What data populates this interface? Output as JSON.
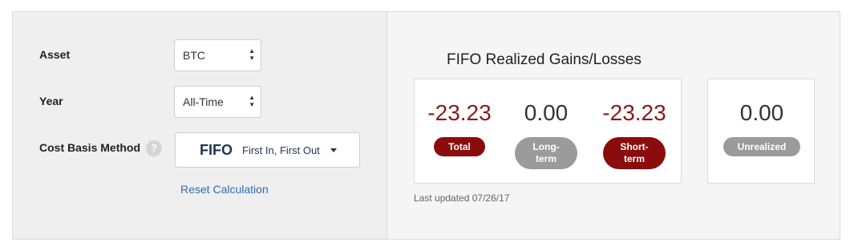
{
  "form": {
    "asset_label": "Asset",
    "asset_value": "BTC",
    "year_label": "Year",
    "year_value": "All-Time",
    "method_label": "Cost Basis Method",
    "help_icon": "?",
    "method_abbr": "FIFO",
    "method_full": "First In, First Out",
    "reset_label": "Reset Calculation"
  },
  "gains": {
    "title": "FIFO Realized Gains/Losses",
    "total_value": "-23.23",
    "total_label": "Total",
    "long_value": "0.00",
    "long_label_1": "Long-",
    "long_label_2": "term",
    "short_value": "-23.23",
    "short_label_1": "Short-",
    "short_label_2": "term",
    "unrealized_value": "0.00",
    "unrealized_label": "Unrealized",
    "last_updated": "Last updated 07/26/17"
  },
  "colors": {
    "negative": "#8b1a1a",
    "pill_red": "#8b0c0c",
    "pill_gray": "#9b9b9b",
    "link": "#2b6fb6"
  },
  "icons": {
    "select_arrows": "updown-arrows-icon",
    "dropdown_caret": "caret-down-icon",
    "help": "question-mark-icon"
  }
}
